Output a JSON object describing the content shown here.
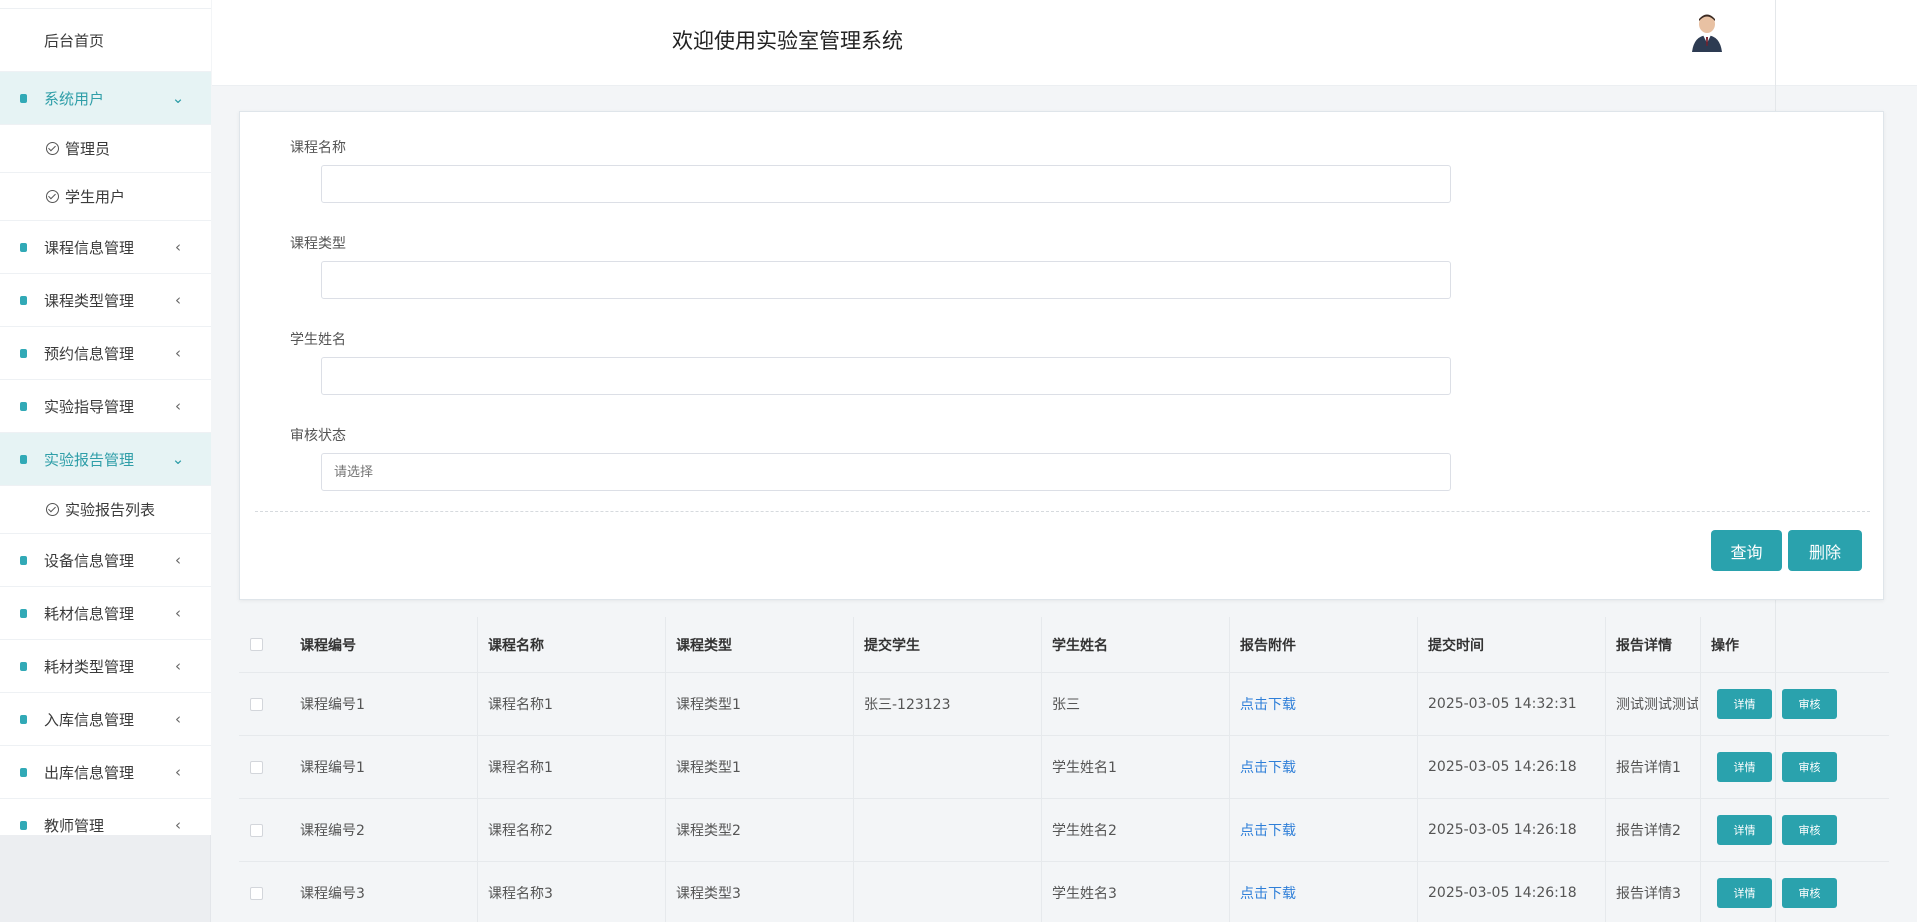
{
  "header": {
    "title": "欢迎使用实验室管理系统"
  },
  "sidebar": {
    "home": "后台首页",
    "groups": [
      {
        "label": "系统用户",
        "arrow": "⌄",
        "subs": [
          "管理员",
          "学生用户"
        ]
      },
      {
        "label": "课程信息管理",
        "arrow": "‹"
      },
      {
        "label": "课程类型管理",
        "arrow": "‹"
      },
      {
        "label": "预约信息管理",
        "arrow": "‹"
      },
      {
        "label": "实验指导管理",
        "arrow": "‹"
      },
      {
        "label": "实验报告管理",
        "arrow": "⌄",
        "subs": [
          "实验报告列表"
        ]
      },
      {
        "label": "设备信息管理",
        "arrow": "‹"
      },
      {
        "label": "耗材信息管理",
        "arrow": "‹"
      },
      {
        "label": "耗材类型管理",
        "arrow": "‹"
      },
      {
        "label": "入库信息管理",
        "arrow": "‹"
      },
      {
        "label": "出库信息管理",
        "arrow": "‹"
      },
      {
        "label": "教师管理",
        "arrow": "‹"
      }
    ]
  },
  "search": {
    "fields": [
      {
        "label": "课程名称",
        "value": "",
        "placeholder": ""
      },
      {
        "label": "课程类型",
        "value": "",
        "placeholder": ""
      },
      {
        "label": "学生姓名",
        "value": "",
        "placeholder": ""
      },
      {
        "label": "审核状态",
        "value": "",
        "placeholder": "请选择"
      }
    ],
    "query_label": "查询",
    "delete_label": "删除"
  },
  "table": {
    "columns": [
      "课程编号",
      "课程名称",
      "课程类型",
      "提交学生",
      "学生姓名",
      "报告附件",
      "提交时间",
      "报告详情",
      "操作"
    ],
    "rows": [
      {
        "code": "课程编号1",
        "name": "课程名称1",
        "type": "课程类型1",
        "student": "张三-123123",
        "sname": "张三",
        "file": "点击下载",
        "time": "2025-03-05 14:32:31",
        "detail": "测试测试测试"
      },
      {
        "code": "课程编号1",
        "name": "课程名称1",
        "type": "课程类型1",
        "student": "",
        "sname": "学生姓名1",
        "file": "点击下载",
        "time": "2025-03-05 14:26:18",
        "detail": "报告详情1"
      },
      {
        "code": "课程编号2",
        "name": "课程名称2",
        "type": "课程类型2",
        "student": "",
        "sname": "学生姓名2",
        "file": "点击下载",
        "time": "2025-03-05 14:26:18",
        "detail": "报告详情2"
      },
      {
        "code": "课程编号3",
        "name": "课程名称3",
        "type": "课程类型3",
        "student": "",
        "sname": "学生姓名3",
        "file": "点击下载",
        "time": "2025-03-05 14:26:18",
        "detail": "报告详情3"
      }
    ],
    "actions": {
      "detail": "详情",
      "audit": "审核"
    }
  },
  "colors": {
    "accent": "#2aa2ad",
    "link": "#2f7fd8",
    "active_bg": "#e6f3f4"
  }
}
